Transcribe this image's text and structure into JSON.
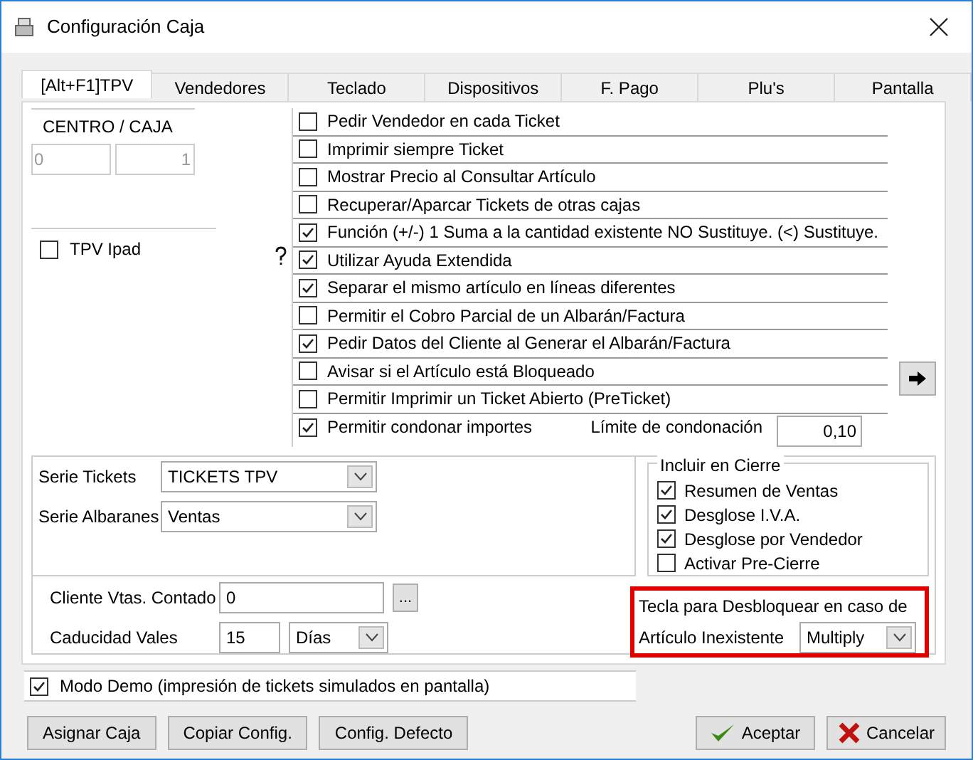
{
  "window": {
    "title": "Configuración Caja"
  },
  "tabs": [
    {
      "label": "[Alt+F1]TPV",
      "selected": true
    },
    {
      "label": "Vendedores",
      "selected": false
    },
    {
      "label": "Teclado",
      "selected": false
    },
    {
      "label": "Dispositivos",
      "selected": false
    },
    {
      "label": "F. Pago",
      "selected": false
    },
    {
      "label": "Plu's",
      "selected": false
    },
    {
      "label": "Pantalla",
      "selected": false
    }
  ],
  "centro_caja": {
    "label": "CENTRO / CAJA",
    "centro": "0",
    "caja": "1"
  },
  "tpv_ipad": {
    "label": "TPV Ipad",
    "checked": false
  },
  "options": [
    {
      "label": "Pedir Vendedor en cada Ticket",
      "checked": false
    },
    {
      "label": "Imprimir siempre Ticket",
      "checked": false
    },
    {
      "label": "Mostrar Precio al Consultar Artículo",
      "checked": false
    },
    {
      "label": "Recuperar/Aparcar Tickets de otras cajas",
      "checked": false
    },
    {
      "label": "Función (+/-) 1 Suma a la cantidad existente NO Sustituye. (<) Sustituye.",
      "checked": true
    },
    {
      "label": "Utilizar Ayuda Extendida",
      "checked": true
    },
    {
      "label": "Separar el mismo artículo en líneas diferentes",
      "checked": true
    },
    {
      "label": "Permitir el Cobro Parcial de un Albarán/Factura",
      "checked": false
    },
    {
      "label": "Pedir Datos del Cliente al Generar el Albarán/Factura",
      "checked": true
    },
    {
      "label": "Avisar si el Artículo está Bloqueado",
      "checked": false
    },
    {
      "label": "Permitir Imprimir un Ticket Abierto (PreTicket)",
      "checked": false
    },
    {
      "label": "Permitir condonar importes",
      "checked": true
    }
  ],
  "limite_condonacion": {
    "label": "Límite de condonación",
    "value": "0,10"
  },
  "series": [
    {
      "label": "Serie Tickets",
      "value": "TICKETS TPV"
    },
    {
      "label": "Serie Albaranes",
      "value": "Ventas"
    }
  ],
  "incluir_en_cierre": {
    "title": "Incluir en Cierre",
    "items": [
      {
        "label": "Resumen de Ventas",
        "checked": true
      },
      {
        "label": "Desglose I.V.A.",
        "checked": true
      },
      {
        "label": "Desglose por Vendedor",
        "checked": true
      },
      {
        "label": "Activar Pre-Cierre",
        "checked": false
      }
    ]
  },
  "cliente_vtas_contado": {
    "label": "Cliente Vtas. Contado",
    "value": "0",
    "browse": "..."
  },
  "caducidad_vales": {
    "label": "Caducidad Vales",
    "value": "15",
    "unit": "Días"
  },
  "tecla_desbloquear": {
    "label": "Tecla para Desbloquear en caso de",
    "label_2": "Artículo Inexistente",
    "value": "Multiply"
  },
  "modo_demo": {
    "label": "Modo Demo (impresión de tickets simulados en pantalla)",
    "checked": true
  },
  "buttons_left": [
    "Asignar Caja",
    "Copiar Config.",
    "Config. Defecto"
  ],
  "buttons_right": [
    {
      "label": "Aceptar",
      "kind": "accept"
    },
    {
      "label": "Cancelar",
      "kind": "cancel"
    }
  ]
}
